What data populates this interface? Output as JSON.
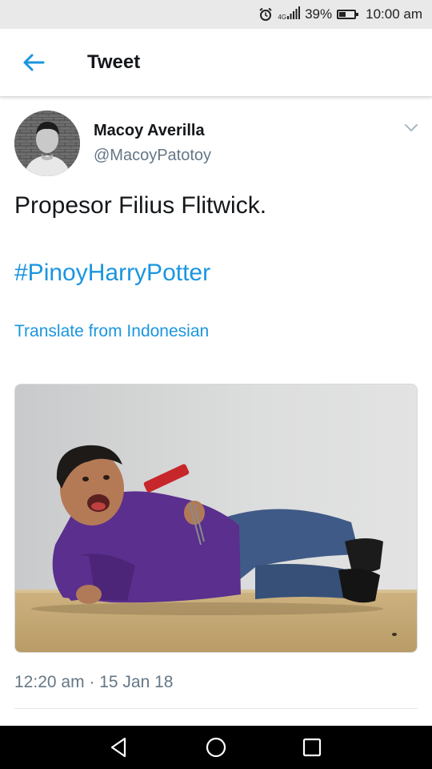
{
  "status_bar": {
    "network": "4G",
    "battery_percent": "39%",
    "battery_level": 0.39,
    "time": "10:00 am",
    "icons": [
      "alarm-icon",
      "signal-icon",
      "battery-icon"
    ]
  },
  "header": {
    "title": "Tweet",
    "back_icon": "arrow-left-icon"
  },
  "tweet": {
    "author_name": "Macoy Averilla",
    "author_handle": "@MacoyPatotoy",
    "text": "Propesor Filius Flitwick.",
    "hashtag": "#PinoyHarryPotter",
    "translate_label": "Translate from Indonesian",
    "timestamp": "12:20 am · 15 Jan 18",
    "menu_icon": "chevron-down-icon",
    "media_icon": "photo-image"
  },
  "nav_bar": {
    "icons": [
      "nav-back-icon",
      "nav-home-icon",
      "nav-recents-icon"
    ]
  },
  "colors": {
    "accent": "#1b95e0",
    "text_primary": "#14171a",
    "text_secondary": "#657786",
    "status_bar_bg": "#e9e9e9",
    "nav_bar_bg": "#000000"
  }
}
